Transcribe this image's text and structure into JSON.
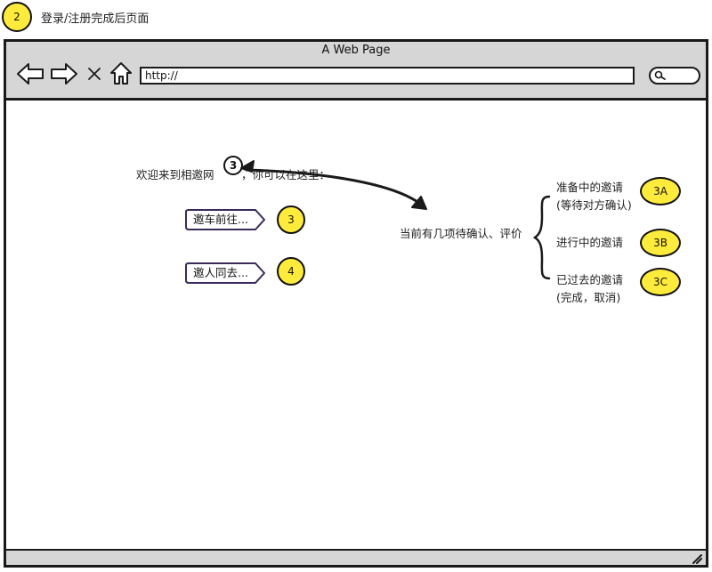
{
  "annotation": {
    "badge": "2",
    "title": "登录/注册完成后页面"
  },
  "browser": {
    "window_title": "A Web Page",
    "url": "http://",
    "nav_icons": [
      "back-icon",
      "forward-icon",
      "close-icon",
      "home-icon"
    ]
  },
  "content": {
    "welcome_prefix": "欢迎来到相邀网",
    "welcome_suffix": "，你可以在这里：",
    "welcome_marker": "3",
    "actions": [
      {
        "label": "邀车前往...",
        "marker": "3"
      },
      {
        "label": "邀人同去...",
        "marker": "4"
      }
    ],
    "pending_text": "当前有几项待确认、评价",
    "invites": [
      {
        "line1": "准备中的邀请",
        "line2": "(等待对方确认)",
        "marker": "3A"
      },
      {
        "line1": "进行中的邀请",
        "line2": "",
        "marker": "3B"
      },
      {
        "line1": "已过去的邀请",
        "line2": "(完成，取消)",
        "marker": "3C"
      }
    ]
  },
  "colors": {
    "highlight": "#ffeb3b",
    "chrome": "#d6d6d6",
    "ink": "#1a1a1a"
  }
}
